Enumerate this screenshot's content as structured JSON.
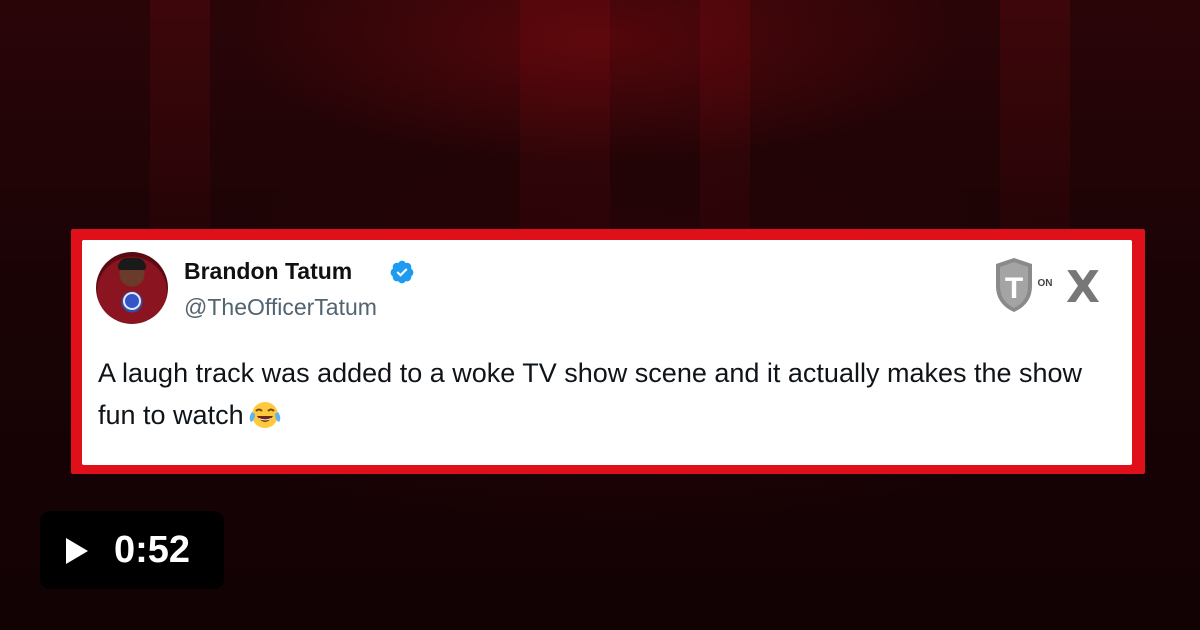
{
  "tweet": {
    "display_name": "Brandon Tatum",
    "handle": "@TheOfficerTatum",
    "text": "A laugh track was added to a woke TV show scene and it actually makes the show fun to watch",
    "emoji": "face-with-tears-of-joy",
    "verified": true
  },
  "branding": {
    "logo_letter": "T",
    "on_label": "ON",
    "platform_letter": "X"
  },
  "video": {
    "duration": "0:52",
    "play_icon": "play-icon"
  },
  "colors": {
    "frame_red": "#e0101a",
    "verified_blue": "#1d9bf0",
    "background_dark_red": "#1a0305"
  }
}
